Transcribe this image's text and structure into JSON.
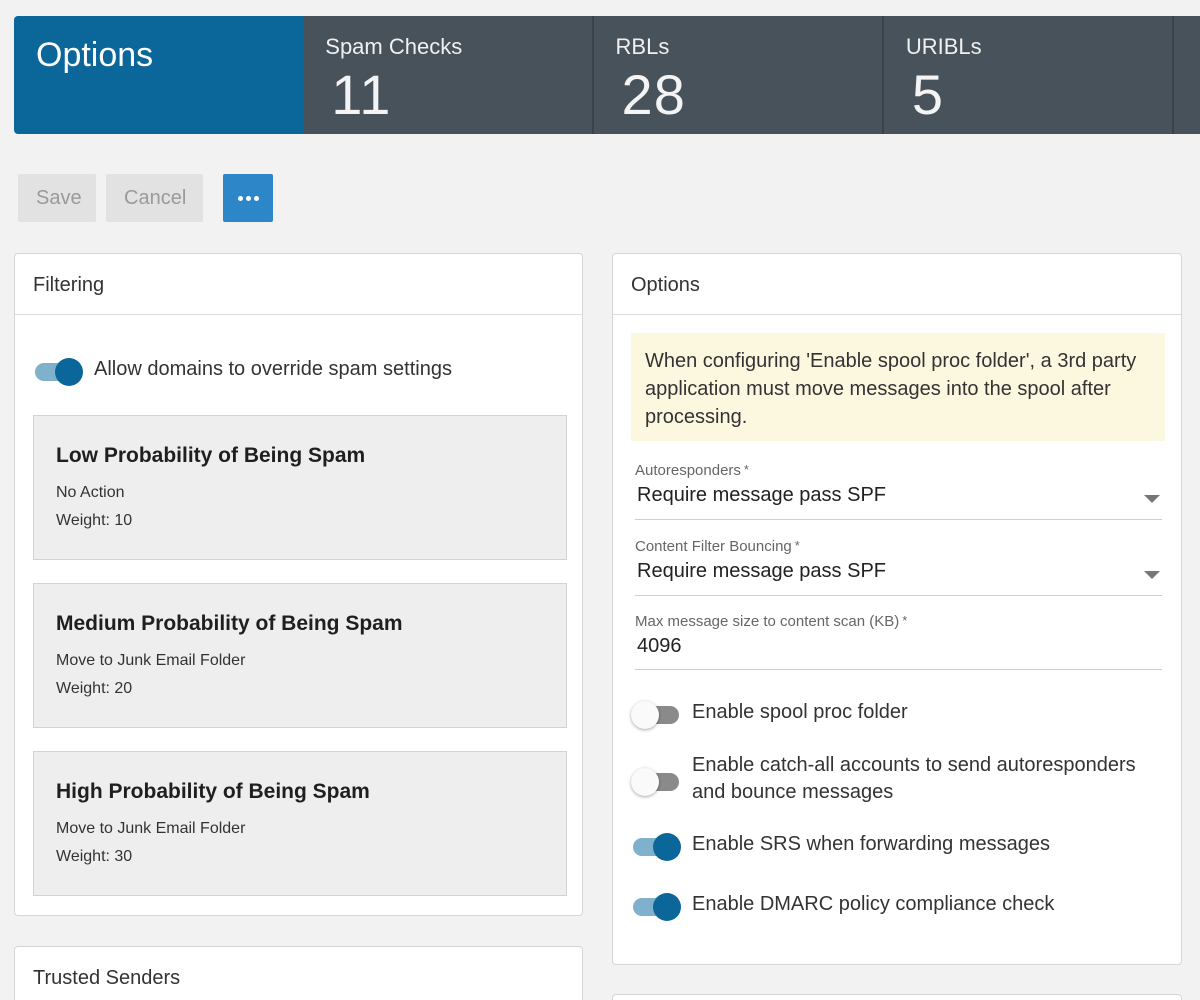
{
  "tiles": {
    "active_title": "Options",
    "stats": [
      {
        "label": "Spam Checks",
        "count": "11"
      },
      {
        "label": "RBLs",
        "count": "28"
      },
      {
        "label": "URIBLs",
        "count": "5"
      }
    ]
  },
  "toolbar": {
    "save_label": "Save",
    "cancel_label": "Cancel",
    "more_icon": "ellipsis-icon"
  },
  "filtering": {
    "title": "Filtering",
    "override_toggle": {
      "label": "Allow domains to override spam settings",
      "on": true
    },
    "cards": [
      {
        "title": "Low Probability of Being Spam",
        "action": "No Action",
        "weight": "Weight: 10"
      },
      {
        "title": "Medium Probability of Being Spam",
        "action": "Move to Junk Email Folder",
        "weight": "Weight: 20"
      },
      {
        "title": "High Probability of Being Spam",
        "action": "Move to Junk Email Folder",
        "weight": "Weight: 30"
      }
    ]
  },
  "options": {
    "title": "Options",
    "notice": "When configuring 'Enable spool proc folder', a 3rd party application must move messages into the spool after processing.",
    "fields": [
      {
        "label": "Autoresponders",
        "required": "*",
        "value": "Require message pass SPF"
      },
      {
        "label": "Content Filter Bouncing",
        "required": "*",
        "value": "Require message pass SPF"
      },
      {
        "label": "Max message size to content scan (KB)",
        "required": "*",
        "value": "4096"
      }
    ],
    "toggles": [
      {
        "label": "Enable spool proc folder",
        "on": false
      },
      {
        "label": "Enable catch-all accounts to send autoresponders and bounce messages",
        "on": false
      },
      {
        "label": "Enable SRS when forwarding messages",
        "on": true
      },
      {
        "label": "Enable DMARC policy compliance check",
        "on": true
      }
    ]
  },
  "trusted_senders": {
    "title": "Trusted Senders"
  },
  "colors": {
    "accent": "#0b6699",
    "tile_bg": "#48525a",
    "primary_button": "#2c86c8",
    "notice_bg": "#fcf8e0"
  }
}
